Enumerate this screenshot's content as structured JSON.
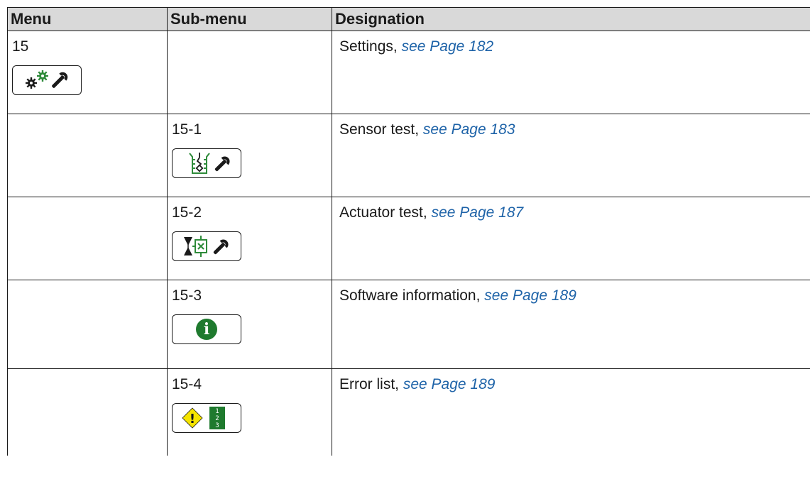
{
  "header": {
    "menu": "Menu",
    "submenu": "Sub-menu",
    "designation": "Designation"
  },
  "rows": [
    {
      "menu": "15",
      "submenu": "",
      "designation": "Settings",
      "link": "see Page 182",
      "icon": "settings-wrench-icon"
    },
    {
      "menu": "",
      "submenu": "15-1",
      "designation": "Sensor test",
      "link": "see Page 183",
      "icon": "sensor-test-icon"
    },
    {
      "menu": "",
      "submenu": "15-2",
      "designation": "Actuator test",
      "link": "see Page 187",
      "icon": "actuator-test-icon"
    },
    {
      "menu": "",
      "submenu": "15-3",
      "designation": "Software information",
      "link": "see Page 189",
      "icon": "info-icon"
    },
    {
      "menu": "",
      "submenu": "15-4",
      "designation": "Error list",
      "link": "see Page 189",
      "icon": "error-list-icon"
    }
  ],
  "separator": ", ",
  "error_list_numbers": [
    "1",
    "2",
    "3"
  ],
  "info_glyph": "i",
  "warning_glyph": "!",
  "colors": {
    "header_bg": "#d9d9d9",
    "link": "#1e63a8",
    "icon_green": "#2e8b3a",
    "info_green": "#1f7a2e",
    "warning_yellow": "#f5e400"
  }
}
